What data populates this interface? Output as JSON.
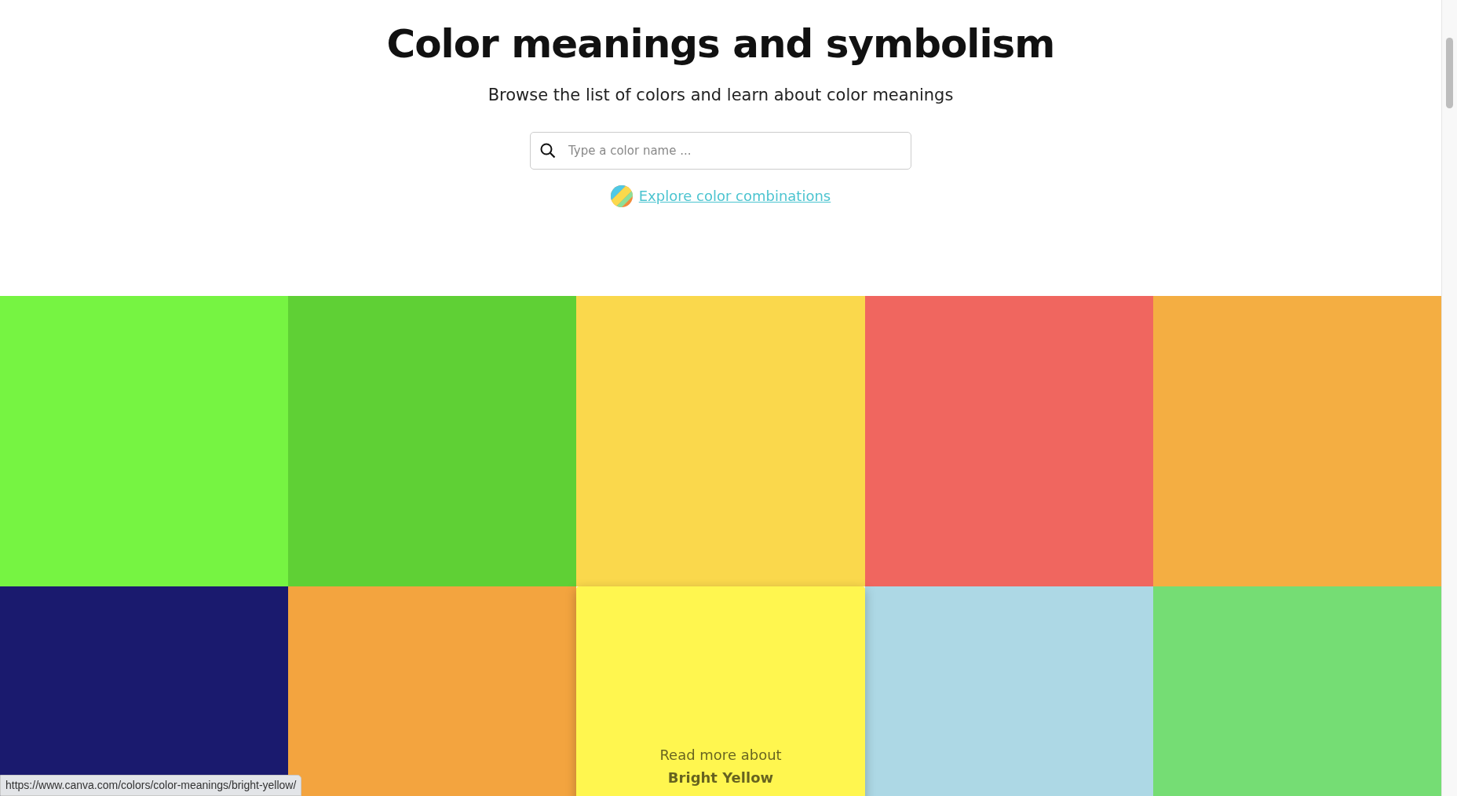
{
  "header": {
    "title": "Color meanings and symbolism",
    "subtitle": "Browse the list of colors and learn about color meanings"
  },
  "search": {
    "placeholder": "Type a color name ..."
  },
  "combinations_link": "Explore color combinations",
  "swatches": [
    {
      "color": "#76f442",
      "hovered": false
    },
    {
      "color": "#5fd035",
      "hovered": false
    },
    {
      "color": "#fad84c",
      "hovered": false
    },
    {
      "color": "#f0665f",
      "hovered": false
    },
    {
      "color": "#f4ae42",
      "hovered": false
    },
    {
      "color": "#1a1a6e",
      "hovered": false
    },
    {
      "color": "#f3a43f",
      "hovered": false
    },
    {
      "color": "#fff64f",
      "hovered": true,
      "caption": "Read more about",
      "name": "Bright Yellow"
    },
    {
      "color": "#add8e5",
      "hovered": false
    },
    {
      "color": "#75dd74",
      "hovered": false
    }
  ],
  "status_bar": {
    "url": "https://www.canva.com/colors/color-meanings/bright-yellow/"
  }
}
